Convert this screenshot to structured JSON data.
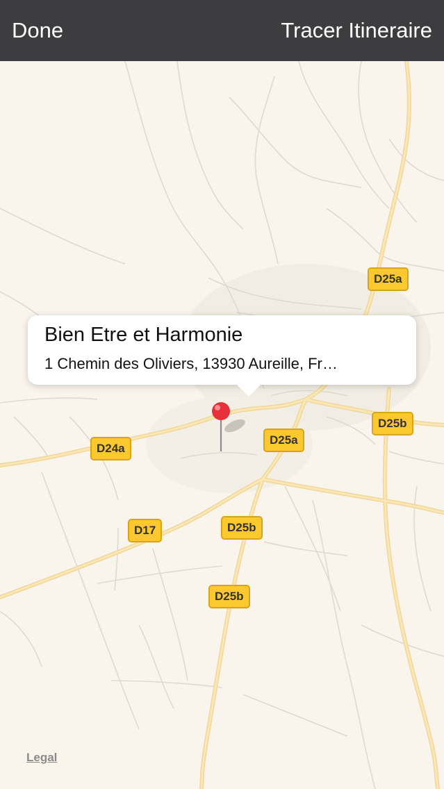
{
  "nav": {
    "done_label": "Done",
    "route_label": "Tracer Itineraire"
  },
  "callout": {
    "title": "Bien Etre et Harmonie",
    "subtitle": "1 Chemin des Oliviers, 13930 Aureille, Fr…"
  },
  "road_labels": {
    "d25a_north": "D25a",
    "d25b_east": "D25b",
    "d25a_center": "D25a",
    "d24a": "D24a",
    "d17": "D17",
    "d25b_center": "D25b",
    "d25b_south": "D25b"
  },
  "legal_label": "Legal",
  "colors": {
    "nav_background": "#3d3d3f",
    "map_background": "#f9f5ed",
    "road_badge": "#fbc82e",
    "pin": "#e8303a"
  },
  "icons": {
    "pin": "map-pin-icon"
  }
}
